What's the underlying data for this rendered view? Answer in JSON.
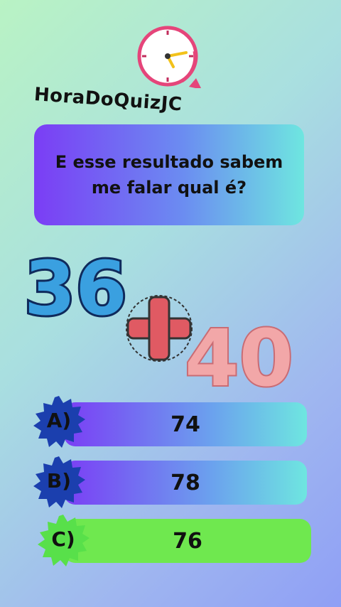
{
  "brand": "HoraDoQuizJC",
  "question": "E esse resultado sabem\nme falar qual é?",
  "equation": {
    "left": "36",
    "operator": "+",
    "right": "40"
  },
  "options": [
    {
      "letter": "A)",
      "value": "74",
      "badge_color": "#1b3fae"
    },
    {
      "letter": "B)",
      "value": "78",
      "badge_color": "#1b3fae"
    },
    {
      "letter": "C)",
      "value": "76",
      "badge_color": "#58e04a"
    }
  ],
  "icons": {
    "clock": "clock-icon"
  },
  "colors": {
    "option_gradient_start": "#7b3df5",
    "option_gradient_end": "#6ee6e0",
    "correct_option": "#6fe84f",
    "number_36": "#3aa0e0",
    "plus": "#e05a63",
    "number_40": "#f0a0a4"
  }
}
